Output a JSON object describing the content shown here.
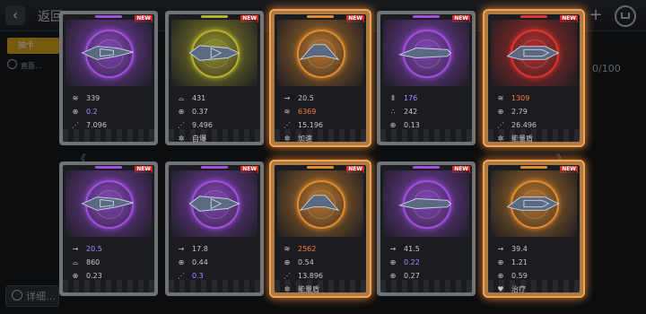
{
  "topbar": {
    "back_icon": "chevron-left-icon",
    "back_label": "返回",
    "plus_label": "+",
    "cart_icon": "shop-cart-icon"
  },
  "background": {
    "tab_label": "抽卡",
    "info_text": "直面…",
    "count_text": "0/100",
    "detail_label": "详细…"
  },
  "colors": {
    "purple": "#a14fe0",
    "olive": "#b6b12c",
    "orange": "#e08b2e",
    "red": "#e0332e",
    "highlight_violet": "#a78cff",
    "highlight_orange": "#ff7a3a",
    "new_badge": "#e2231a"
  },
  "cards": [
    {
      "rarity": "purple",
      "new_label": "NEW",
      "glow": false,
      "stats": [
        {
          "icon": "armor-icon",
          "value": "339",
          "color": "#c8c8c8"
        },
        {
          "icon": "crosshair-icon",
          "value": "0.2",
          "color": "#a78cff"
        },
        {
          "icon": "damage-icon",
          "value": "7.096",
          "color": "#c8c8c8"
        }
      ]
    },
    {
      "rarity": "olive",
      "new_label": "NEW",
      "glow": false,
      "stats": [
        {
          "icon": "shield-dome-icon",
          "value": "431",
          "color": "#c8c8c8"
        },
        {
          "icon": "crosshair-icon",
          "value": "0.37",
          "color": "#c8c8c8"
        },
        {
          "icon": "damage-icon",
          "value": "9.496",
          "color": "#c8c8c8"
        },
        {
          "icon": "skill-icon",
          "value": "自爆",
          "color": "#c8c8c8"
        }
      ]
    },
    {
      "rarity": "orange",
      "new_label": "NEW",
      "glow": true,
      "stats": [
        {
          "icon": "speed-arrow-icon",
          "value": "20.5",
          "color": "#c8c8c8"
        },
        {
          "icon": "armor-icon",
          "value": "6369",
          "color": "#ff7a3a"
        },
        {
          "icon": "damage-icon",
          "value": "15.196",
          "color": "#c8c8c8"
        },
        {
          "icon": "skill-icon",
          "value": "加速",
          "color": "#c8c8c8"
        }
      ]
    },
    {
      "rarity": "purple",
      "new_label": "NEW",
      "glow": false,
      "stats": [
        {
          "icon": "bar-stat-icon",
          "value": "176",
          "color": "#a78cff"
        },
        {
          "icon": "triple-dot-icon",
          "value": "242",
          "color": "#c8c8c8"
        },
        {
          "icon": "crosshair-icon",
          "value": "0.13",
          "color": "#c8c8c8"
        }
      ]
    },
    {
      "rarity": "red",
      "new_label": "NEW",
      "glow": true,
      "stats": [
        {
          "icon": "armor-icon",
          "value": "1309",
          "color": "#ff7a3a"
        },
        {
          "icon": "crosshair-icon",
          "value": "2.79",
          "color": "#c8c8c8"
        },
        {
          "icon": "damage-icon",
          "value": "26.496",
          "color": "#c8c8c8"
        },
        {
          "icon": "skill-icon",
          "value": "能量盾",
          "color": "#c8c8c8"
        }
      ]
    },
    {
      "rarity": "purple",
      "new_label": "NEW",
      "glow": false,
      "stats": [
        {
          "icon": "speed-arrow-icon",
          "value": "20.5",
          "color": "#a78cff"
        },
        {
          "icon": "shield-dome-icon",
          "value": "860",
          "color": "#c8c8c8"
        },
        {
          "icon": "crosshair-icon",
          "value": "0.23",
          "color": "#c8c8c8"
        }
      ]
    },
    {
      "rarity": "purple",
      "new_label": "NEW",
      "glow": false,
      "stats": [
        {
          "icon": "speed-arrow-icon",
          "value": "17.8",
          "color": "#c8c8c8"
        },
        {
          "icon": "crosshair-icon",
          "value": "0.44",
          "color": "#c8c8c8"
        },
        {
          "icon": "damage-icon",
          "value": "0.3",
          "color": "#a78cff"
        }
      ]
    },
    {
      "rarity": "orange",
      "new_label": "NEW",
      "glow": true,
      "stats": [
        {
          "icon": "armor-icon",
          "value": "2562",
          "color": "#ff7a3a"
        },
        {
          "icon": "crosshair-icon",
          "value": "0.54",
          "color": "#c8c8c8"
        },
        {
          "icon": "damage-icon",
          "value": "13.896",
          "color": "#c8c8c8"
        },
        {
          "icon": "skill-icon",
          "value": "能量盾",
          "color": "#c8c8c8"
        }
      ]
    },
    {
      "rarity": "purple",
      "new_label": "NEW",
      "glow": false,
      "stats": [
        {
          "icon": "speed-arrow-icon",
          "value": "41.5",
          "color": "#c8c8c8"
        },
        {
          "icon": "crosshair-icon",
          "value": "0.22",
          "color": "#a78cff"
        },
        {
          "icon": "crosshair-icon",
          "value": "0.27",
          "color": "#c8c8c8"
        }
      ]
    },
    {
      "rarity": "orange",
      "new_label": "NEW",
      "glow": true,
      "stats": [
        {
          "icon": "speed-arrow-icon",
          "value": "39.4",
          "color": "#c8c8c8"
        },
        {
          "icon": "crosshair-icon",
          "value": "1.21",
          "color": "#c8c8c8"
        },
        {
          "icon": "crosshair-icon",
          "value": "0.59",
          "color": "#c8c8c8"
        },
        {
          "icon": "heal-icon",
          "value": "治疗",
          "color": "#c8c8c8"
        }
      ]
    }
  ]
}
